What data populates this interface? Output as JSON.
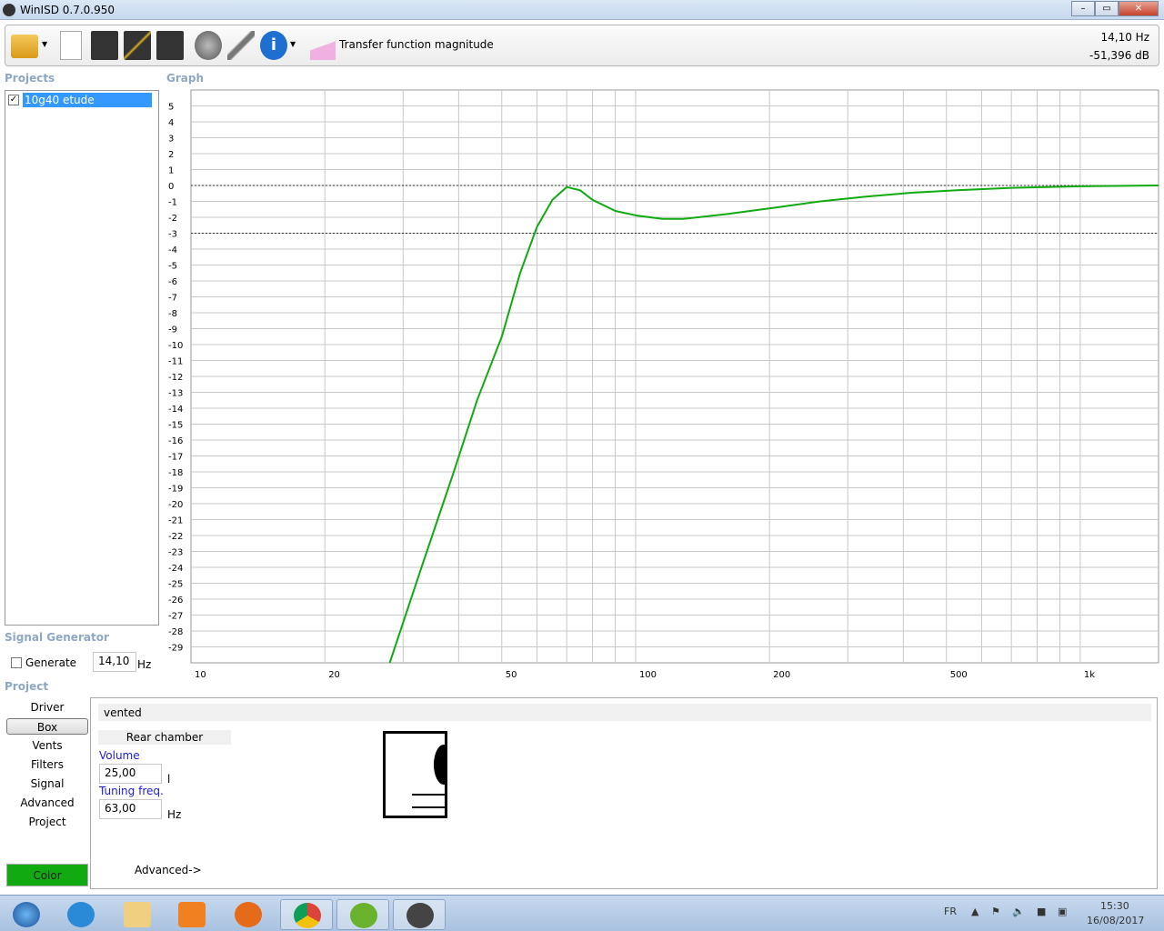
{
  "window": {
    "title": "WinISD 0.7.0.950"
  },
  "toolbar": {
    "graph_label": "Transfer function magnitude",
    "readout_freq": "14,10 Hz",
    "readout_db": "-51,396 dB"
  },
  "sections": {
    "projects": "Projects",
    "graph": "Graph",
    "signal_generator": "Signal Generator",
    "project": "Project"
  },
  "projects": [
    {
      "name": "10g40 etude",
      "checked": true
    }
  ],
  "signal": {
    "generate_label": "Generate",
    "freq_value": "14,10",
    "unit": "Hz"
  },
  "nav": [
    "Driver",
    "Box",
    "Vents",
    "Filters",
    "Signal",
    "Advanced",
    "Project"
  ],
  "nav_active": "Box",
  "color_label": "Color",
  "color_value": "#11aa11",
  "box": {
    "type": "vented",
    "rear_chamber": "Rear chamber",
    "volume_label": "Volume",
    "volume_value": "25,00",
    "volume_unit": "l",
    "tuning_label": "Tuning freq.",
    "tuning_value": "63,00",
    "tuning_unit": "Hz",
    "advanced_link": "Advanced->"
  },
  "taskbar": {
    "lang": "FR",
    "time": "15:30",
    "date": "16/08/2017"
  },
  "chart_data": {
    "type": "line",
    "title": "Transfer function magnitude",
    "xscale": "log",
    "xlim": [
      10,
      1500
    ],
    "ylim": [
      -30,
      6
    ],
    "x_ticks": [
      {
        "v": 10,
        "l": "10"
      },
      {
        "v": 20,
        "l": "20"
      },
      {
        "v": 50,
        "l": "50"
      },
      {
        "v": 100,
        "l": "100"
      },
      {
        "v": 200,
        "l": "200"
      },
      {
        "v": 500,
        "l": "500"
      },
      {
        "v": 1000,
        "l": "1k"
      }
    ],
    "y_ticks": [
      5,
      4,
      3,
      2,
      1,
      0,
      -1,
      -2,
      -3,
      -4,
      -5,
      -6,
      -7,
      -8,
      -9,
      -10,
      -11,
      -12,
      -13,
      -14,
      -15,
      -16,
      -17,
      -18,
      -19,
      -20,
      -21,
      -22,
      -23,
      -24,
      -25,
      -26,
      -27,
      -28,
      -29
    ],
    "reference_lines": [
      0,
      -3
    ],
    "grid": true,
    "series": [
      {
        "name": "10g40 etude",
        "color": "#11aa11",
        "x": [
          28,
          33,
          39,
          44,
          50,
          55,
          60,
          65,
          70,
          75,
          80,
          90,
          101,
          115,
          128,
          160,
          205,
          260,
          330,
          420,
          528,
          700,
          843,
          1000,
          1500
        ],
        "y": [
          -30,
          -24,
          -18,
          -13.5,
          -9.5,
          -5.5,
          -2.6,
          -0.9,
          -0.1,
          -0.3,
          -0.9,
          -1.6,
          -1.9,
          -2.1,
          -2.1,
          -1.8,
          -1.4,
          -1.0,
          -0.7,
          -0.45,
          -0.3,
          -0.15,
          -0.1,
          -0.05,
          0
        ]
      }
    ]
  }
}
